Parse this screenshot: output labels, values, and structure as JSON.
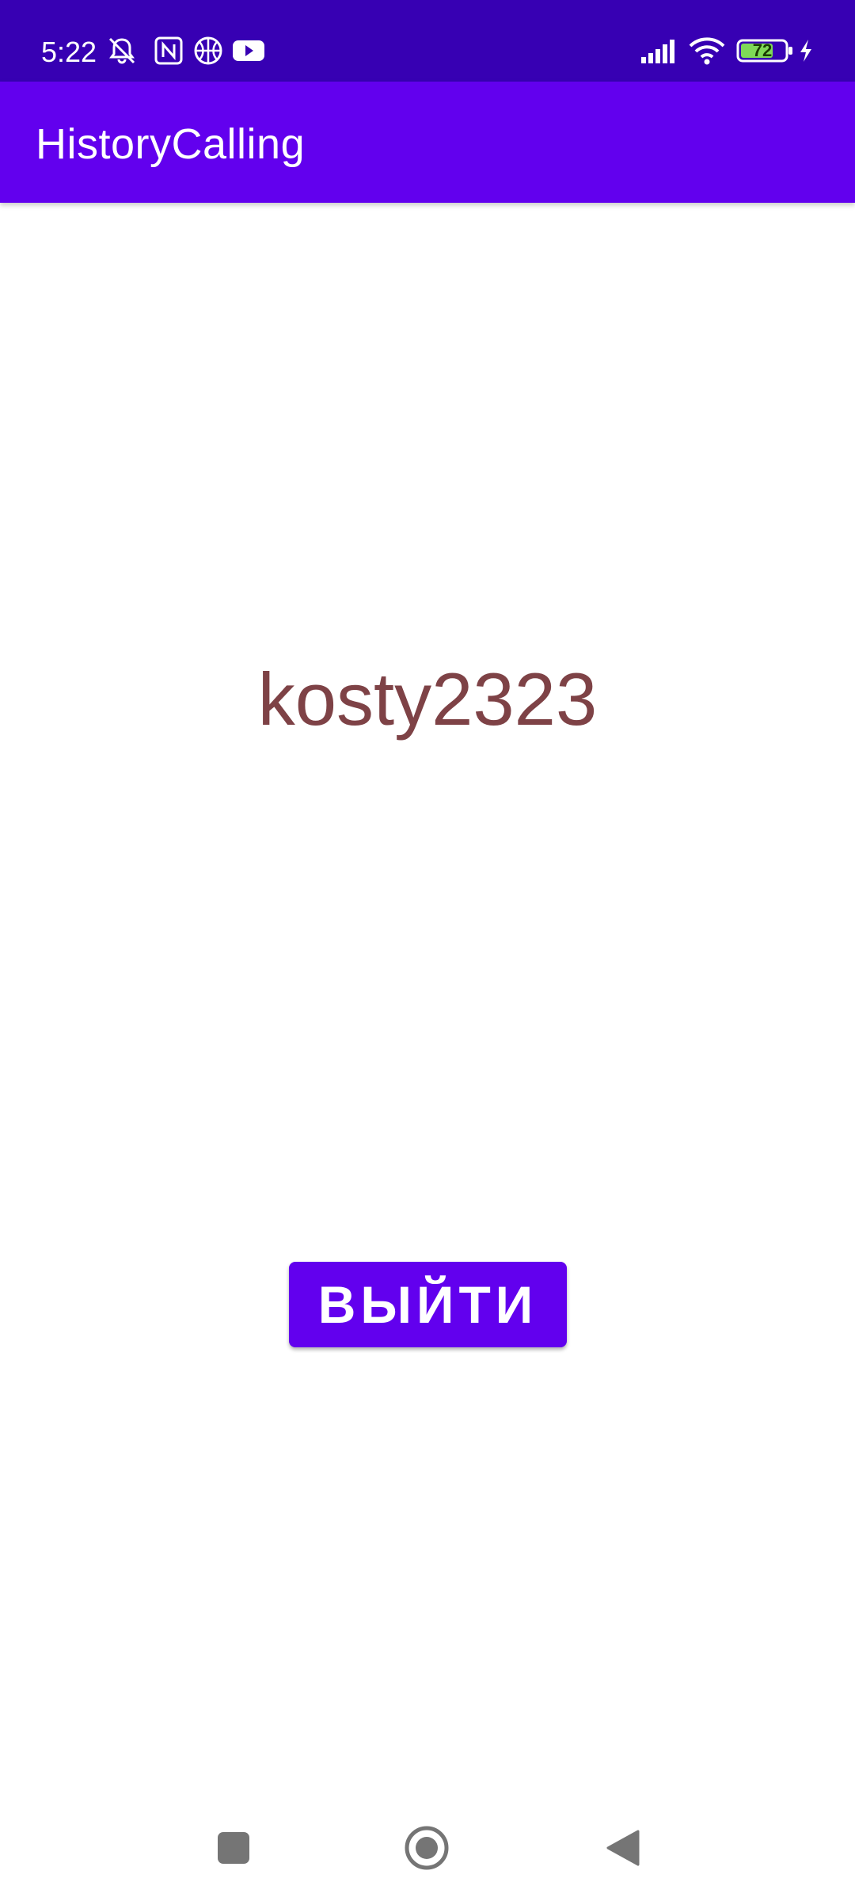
{
  "status_bar": {
    "time": "5:22",
    "battery_level": "72",
    "icons": [
      "muted-bell-icon",
      "nfc-icon",
      "basketball-icon",
      "youtube-icon",
      "signal-icon",
      "wifi-icon",
      "battery-icon",
      "charging-icon"
    ]
  },
  "app_bar": {
    "title": "HistoryCalling"
  },
  "main": {
    "username": "kosty2323",
    "logout_label": "ВЫЙТИ"
  },
  "nav_bar": {
    "icons": [
      "recents-icon",
      "home-icon",
      "back-icon"
    ]
  },
  "colors": {
    "status_bar": "#3700b3",
    "primary": "#6200ee",
    "username_text": "#7e4246",
    "background": "#ffffff"
  }
}
